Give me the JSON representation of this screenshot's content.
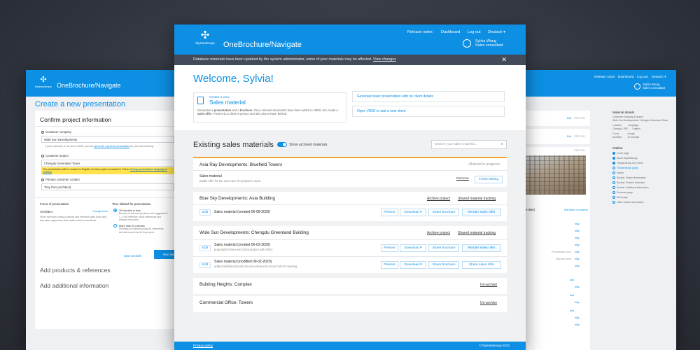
{
  "brand": {
    "logo_text": "thyssenkrupp",
    "logo_glyph": "✣",
    "app_title": "OneBrochure/Navigate"
  },
  "nav": {
    "release_notes": "Release notes",
    "dashboard": "Dashboard",
    "logout": "Log out",
    "language": "Deutsch ▾"
  },
  "user": {
    "name": "Sylvia Wong",
    "role": "Sales consultant"
  },
  "left_window": {
    "page_heading": "Create a new presentation",
    "confirm_title": "Confirm project information",
    "step_label": "STEP",
    "customer_company_label": "Customer company",
    "customer_company_value": "Wide Sun Developments",
    "customer_company_hint": "If your customer is not yet in VIEW, you can",
    "customer_company_hint_link": "generate a generic presentation",
    "customer_company_hint_tail": "for your first meeting.",
    "customer_project_label": "Customer project",
    "customer_project_value": "Chengdu Greenland Tower",
    "warning_text": "The presentation will be created in English, but the project is located in China.",
    "warning_link": "Change presentation language to Chinese",
    "primary_contact_label": "Primary customer contact",
    "primary_contact_value": "Tony Pan (architect)",
    "focus_title": "Focus of presentation",
    "focus_value": "Architect",
    "focus_change": "Change focus",
    "focus_desc": "Short overview of key products and relevant sales tools and key sales arguments that matter most to architects.",
    "time_title": "Time allotted for presentation",
    "time_opt1": "20 minutes or less",
    "time_opt1_desc": "Preview of selected products and suggested & 1 - 10% reference, short references and relevant resources.",
    "time_opt2": "More than 20 minutes",
    "time_opt2_desc": "Previews for relevant products, references and sales tools that fit the project.",
    "save_draft": "Save as draft",
    "next_step": "Next step",
    "accordion_products": "Add products & references",
    "accordion_info": "Add additional information"
  },
  "right_window": {
    "edit_label": "Edit",
    "step_label": "STEP 5/5",
    "up_to_date": "p-to-date)",
    "edit_contents": "Edit table of contents",
    "details_title": "Material details",
    "details_lines": [
      "Customer company & project",
      "Wide Sun Developments, Chengdu Greenland Tower",
      "Location          Language",
      "Chengdu, PRC      English",
      "Focus             Length",
      "Architect         20 minutes"
    ],
    "outline_title": "Outline",
    "outline_items": [
      "Cover page",
      "About thyssenkrupp",
      "Thyssenkrupp Key Facts",
      "Thyssenkrupp goals",
      "Values",
      "Section: Project information",
      "Section: Product Overview",
      "Section: Additional information",
      "Summary page",
      "Back page",
      "Office contact information"
    ],
    "tags": [
      "Map",
      "Map",
      "Map",
      "Map",
      "Presentation time",
      "Map",
      "Standard time",
      "Map",
      "Map",
      "Add",
      "Map",
      "Add",
      "Map",
      "Add",
      "Map",
      "Map"
    ]
  },
  "main": {
    "banner_text": "Database materials have been updated by the system administrator, some of your materials may be affected.",
    "banner_link": "View changes",
    "close": "✕",
    "welcome": "Welcome, Sylvia!",
    "create_new": "Create a new",
    "sales_material": "Sales material",
    "create_desc_1": "Generates a",
    "create_desc_b1": "presentation",
    "create_desc_2": "and a",
    "create_desc_b2": "brochure",
    "create_desc_3": ". Once relevant documents have been added in VIEW, can create a",
    "create_desc_b3": "sales offer",
    "create_desc_4": ". Present to a client in-person and also give a leave-behind.",
    "link_generic": "Generate basic presentation with no client details",
    "link_open_view": "Open VIEW to add a new client",
    "section_title": "Existing sales materials",
    "show_archived": "Show archived materials",
    "search_placeholder": "Search your sales material ...",
    "projects": [
      {
        "name": "Asia Ray Developments: Bluefield Towers",
        "status": "Material in progress",
        "material_title": "Sales material",
        "material_sub": "pastel offer for the new Lam Tin project in June.",
        "remove": "Remove",
        "finish": "Finish editing"
      },
      {
        "name": "Blue Sky Developments: Asia Building",
        "archive": "Archive project",
        "shared": "Shared material tracking",
        "rows": [
          {
            "edit": "Edit",
            "title": "Sales material",
            "date": "(created 06-08-2020)",
            "sub": "",
            "b1": "Present",
            "b2": "Download ▾",
            "b3": "Share brochure",
            "b4": "Render sales offer"
          }
        ]
      },
      {
        "name": "Wide Sun Developments: Chengdu Greenland Building",
        "archive": "Archive project",
        "shared": "Shared material tracking",
        "rows": [
          {
            "edit": "Edit",
            "title": "Sales material",
            "date": "(created 06-02-2020)",
            "sub": "proposal for the new China project with IFEO",
            "b1": "Present",
            "b2": "Download ▾",
            "b3": "Share brochure",
            "b4": "Render sales offer"
          },
          {
            "edit": "Edit",
            "title": "Sales material",
            "date": "(modified 09-02-2020)",
            "sub": "added additional products and references since Feb 02 meeting",
            "b1": "Present",
            "b2": "Download ▾",
            "b3": "Share brochure",
            "b4": "Share sales offer"
          }
        ]
      },
      {
        "name": "Building Heights: Complex",
        "unarchive": "Un-archive"
      },
      {
        "name": "Commercial Office: Towers",
        "unarchive": "Un-archive"
      }
    ],
    "footer_privacy": "Privacy policy",
    "footer_copyright": "© thyssenkrupp 2020"
  },
  "colors": {
    "brand_blue": "#0d8fe3",
    "banner_dark": "#414b59",
    "warning_yellow": "#ffe34d"
  }
}
